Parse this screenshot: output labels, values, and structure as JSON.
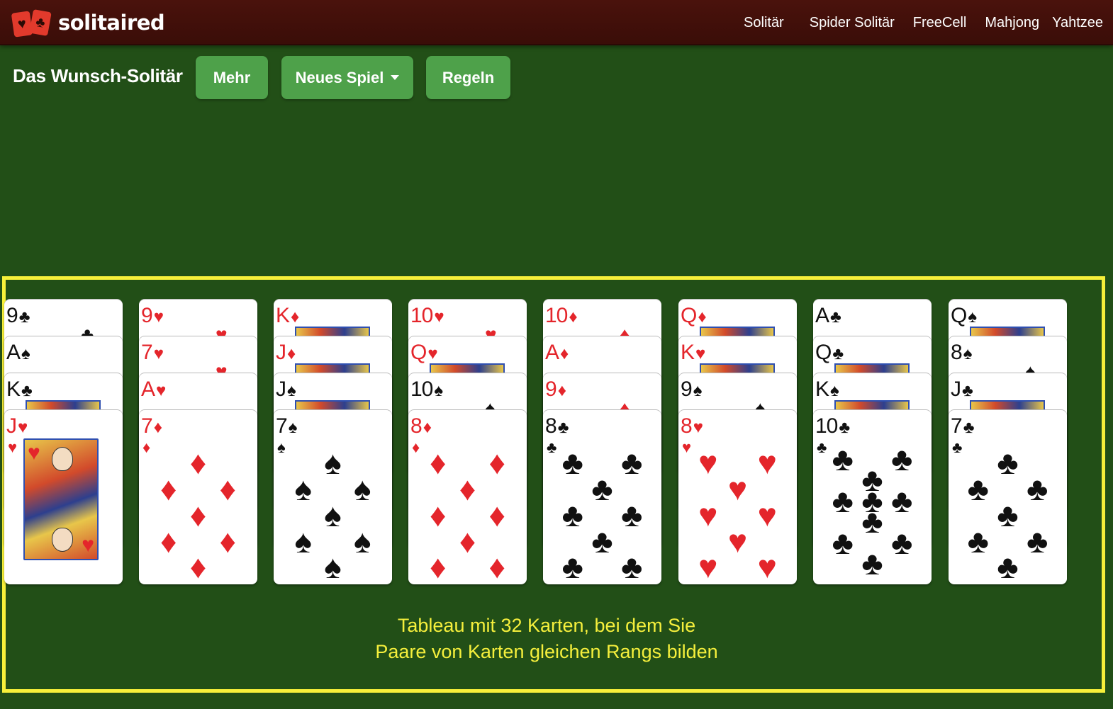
{
  "header": {
    "logo_text": "solitaired",
    "nav": [
      "Solitär",
      "Spider Solitär",
      "FreeCell",
      "Mahjong",
      "Yahtzee"
    ]
  },
  "toolbar": {
    "title": "Das Wunsch-Solitär",
    "mehr_label": "Mehr",
    "new_game_label": "Neues Spiel",
    "rules_label": "Regeln"
  },
  "tableau": [
    {
      "cards": [
        {
          "rank": "9",
          "suit": "♣",
          "color": "black"
        },
        {
          "rank": "A",
          "suit": "♠",
          "color": "black"
        },
        {
          "rank": "K",
          "suit": "♣",
          "color": "black"
        },
        {
          "rank": "J",
          "suit": "♥",
          "color": "red"
        }
      ]
    },
    {
      "cards": [
        {
          "rank": "9",
          "suit": "♥",
          "color": "red"
        },
        {
          "rank": "7",
          "suit": "♥",
          "color": "red"
        },
        {
          "rank": "A",
          "suit": "♥",
          "color": "red"
        },
        {
          "rank": "7",
          "suit": "♦",
          "color": "red"
        }
      ]
    },
    {
      "cards": [
        {
          "rank": "K",
          "suit": "♦",
          "color": "red"
        },
        {
          "rank": "J",
          "suit": "♦",
          "color": "red"
        },
        {
          "rank": "J",
          "suit": "♠",
          "color": "black"
        },
        {
          "rank": "7",
          "suit": "♠",
          "color": "black"
        }
      ]
    },
    {
      "cards": [
        {
          "rank": "10",
          "suit": "♥",
          "color": "red"
        },
        {
          "rank": "Q",
          "suit": "♥",
          "color": "red"
        },
        {
          "rank": "10",
          "suit": "♠",
          "color": "black"
        },
        {
          "rank": "8",
          "suit": "♦",
          "color": "red"
        }
      ]
    },
    {
      "cards": [
        {
          "rank": "10",
          "suit": "♦",
          "color": "red"
        },
        {
          "rank": "A",
          "suit": "♦",
          "color": "red"
        },
        {
          "rank": "9",
          "suit": "♦",
          "color": "red"
        },
        {
          "rank": "8",
          "suit": "♣",
          "color": "black"
        }
      ]
    },
    {
      "cards": [
        {
          "rank": "Q",
          "suit": "♦",
          "color": "red"
        },
        {
          "rank": "K",
          "suit": "♥",
          "color": "red"
        },
        {
          "rank": "9",
          "suit": "♠",
          "color": "black"
        },
        {
          "rank": "8",
          "suit": "♥",
          "color": "red"
        }
      ]
    },
    {
      "cards": [
        {
          "rank": "A",
          "suit": "♣",
          "color": "black"
        },
        {
          "rank": "Q",
          "suit": "♣",
          "color": "black"
        },
        {
          "rank": "K",
          "suit": "♠",
          "color": "black"
        },
        {
          "rank": "10",
          "suit": "♣",
          "color": "black"
        }
      ]
    },
    {
      "cards": [
        {
          "rank": "Q",
          "suit": "♠",
          "color": "black"
        },
        {
          "rank": "8",
          "suit": "♠",
          "color": "black"
        },
        {
          "rank": "J",
          "suit": "♣",
          "color": "black"
        },
        {
          "rank": "7",
          "suit": "♣",
          "color": "black"
        }
      ]
    }
  ],
  "caption": {
    "line1": "Tableau mit 32 Karten, bei dem Sie",
    "line2": "Paare von Karten gleichen Rangs bilden"
  },
  "colors": {
    "felt": "#224f17",
    "header": "#3a0d08",
    "button": "#4ea14a",
    "highlight": "#f7f03a",
    "red_suit": "#e4252b"
  }
}
